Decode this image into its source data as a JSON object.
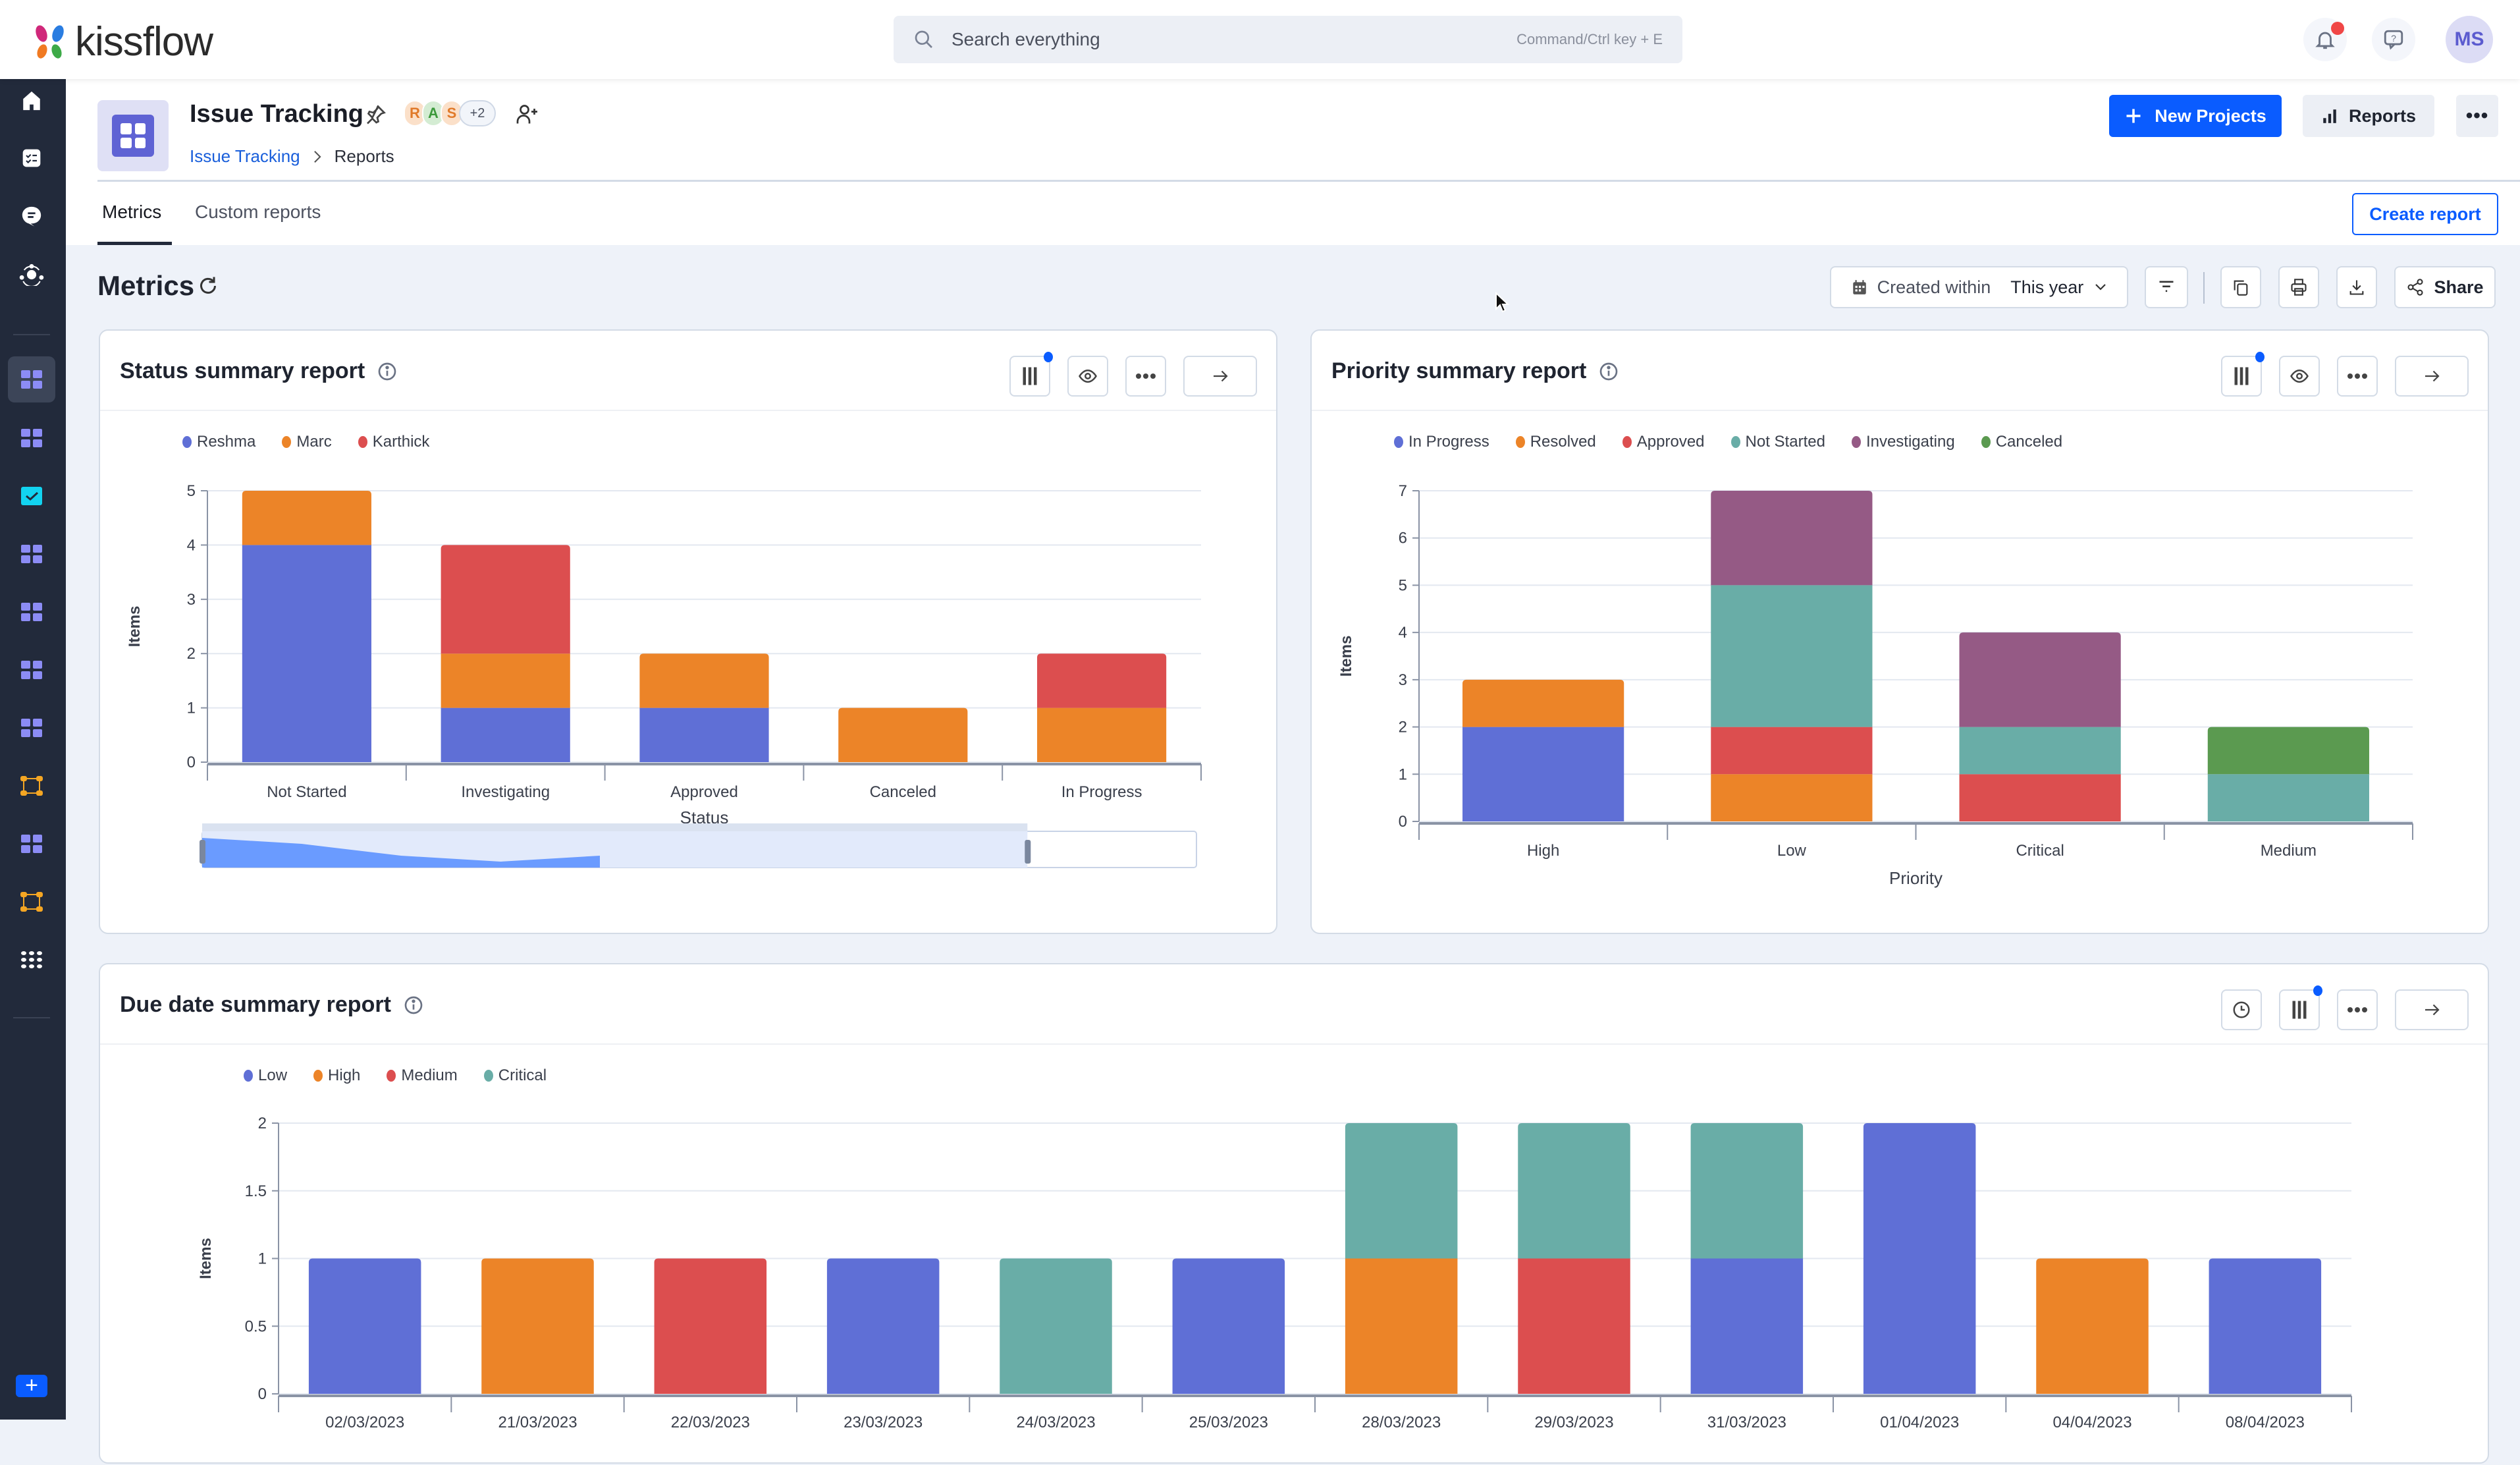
{
  "app": {
    "brand": "kissflow",
    "search_placeholder": "Search everything",
    "search_shortcut": "Command/Ctrl key + E",
    "user_initials": "MS"
  },
  "colors": {
    "primary": "#0a5cff",
    "sidebar_bg": "#222a3b",
    "series_blue": "#5f6fd6",
    "series_orange": "#ec8428",
    "series_red": "#dc4e4f",
    "series_teal": "#69ada7",
    "series_purple": "#955a85",
    "series_green": "#5b9a50"
  },
  "sidebar": {
    "items": [
      {
        "icon": "home-icon"
      },
      {
        "icon": "tasks-icon"
      },
      {
        "icon": "chat-icon"
      },
      {
        "icon": "integrations-icon"
      },
      {
        "icon": "app-grid-icon",
        "active": true
      },
      {
        "icon": "app-grid-icon"
      },
      {
        "icon": "checkbox-icon"
      },
      {
        "icon": "app-grid-icon"
      },
      {
        "icon": "app-grid-icon"
      },
      {
        "icon": "app-grid-icon"
      },
      {
        "icon": "app-grid-icon"
      },
      {
        "icon": "flow-icon"
      },
      {
        "icon": "app-grid-icon"
      },
      {
        "icon": "flow-icon"
      },
      {
        "icon": "all-apps-icon"
      }
    ],
    "add_label": "+"
  },
  "project": {
    "title": "Issue Tracking",
    "members": [
      {
        "initial": "R",
        "bg": "#fbe0c9",
        "fg": "#e07a2a"
      },
      {
        "initial": "A",
        "bg": "#d4ecd3",
        "fg": "#3b9a3b"
      },
      {
        "initial": "S",
        "bg": "#fbe0c9",
        "fg": "#e07a2a"
      }
    ],
    "members_more": "+2",
    "breadcrumb": [
      "Issue Tracking",
      "Reports"
    ],
    "new_button": "New Projects",
    "reports_button": "Reports",
    "more_button": "•••",
    "tabs": [
      "Metrics",
      "Custom reports"
    ],
    "active_tab": "Metrics",
    "create_report": "Create report"
  },
  "metrics": {
    "title": "Metrics",
    "filter_label": "Created within",
    "filter_value": "This year",
    "share_label": "Share"
  },
  "cards": {
    "status": {
      "title": "Status summary report",
      "range_slider": {
        "start_fraction": 0.0,
        "end_fraction": 0.83
      }
    },
    "priority": {
      "title": "Priority summary report"
    },
    "due": {
      "title": "Due date summary report"
    }
  },
  "chart_data": [
    {
      "id": "status",
      "type": "bar",
      "stacked": true,
      "title": "Status summary report",
      "xlabel": "Status",
      "ylabel": "Items",
      "ylim": [
        0,
        5
      ],
      "yticks": [
        0,
        1,
        2,
        3,
        4,
        5
      ],
      "categories": [
        "Not Started",
        "Investigating",
        "Approved",
        "Canceled",
        "In Progress"
      ],
      "series": [
        {
          "name": "Reshma",
          "color": "#5f6fd6",
          "values": [
            4,
            1,
            1,
            0,
            0
          ]
        },
        {
          "name": "Marc",
          "color": "#ec8428",
          "values": [
            1,
            1,
            1,
            1,
            1
          ]
        },
        {
          "name": "Karthick",
          "color": "#dc4e4f",
          "values": [
            0,
            2,
            0,
            0,
            1
          ]
        }
      ],
      "legend": "top-left",
      "grid": true
    },
    {
      "id": "priority",
      "type": "bar",
      "stacked": true,
      "title": "Priority summary report",
      "xlabel": "Priority",
      "ylabel": "Items",
      "ylim": [
        0,
        7
      ],
      "yticks": [
        0,
        1,
        2,
        3,
        4,
        5,
        6,
        7
      ],
      "categories": [
        "High",
        "Low",
        "Critical",
        "Medium"
      ],
      "series": [
        {
          "name": "In Progress",
          "color": "#5f6fd6",
          "values": [
            2,
            0,
            0,
            0
          ]
        },
        {
          "name": "Resolved",
          "color": "#ec8428",
          "values": [
            1,
            1,
            0,
            0
          ]
        },
        {
          "name": "Approved",
          "color": "#dc4e4f",
          "values": [
            0,
            1,
            1,
            0
          ]
        },
        {
          "name": "Not Started",
          "color": "#69ada7",
          "values": [
            0,
            3,
            1,
            1
          ]
        },
        {
          "name": "Investigating",
          "color": "#955a85",
          "values": [
            0,
            2,
            2,
            0
          ]
        },
        {
          "name": "Canceled",
          "color": "#5b9a50",
          "values": [
            0,
            0,
            0,
            1
          ]
        }
      ],
      "legend": "top-left",
      "grid": true
    },
    {
      "id": "due",
      "type": "bar",
      "stacked": true,
      "title": "Due date summary report",
      "xlabel": "",
      "ylabel": "Items",
      "ylim": [
        0,
        2
      ],
      "yticks": [
        0,
        0.5,
        1,
        1.5,
        2
      ],
      "categories": [
        "02/03/2023",
        "21/03/2023",
        "22/03/2023",
        "23/03/2023",
        "24/03/2023",
        "25/03/2023",
        "28/03/2023",
        "29/03/2023",
        "31/03/2023",
        "01/04/2023",
        "04/04/2023",
        "08/04/2023"
      ],
      "series": [
        {
          "name": "Low",
          "color": "#5f6fd6",
          "values": [
            1,
            0,
            0,
            1,
            0,
            1,
            0,
            0,
            1,
            2,
            0,
            1
          ]
        },
        {
          "name": "High",
          "color": "#ec8428",
          "values": [
            0,
            1,
            0,
            0,
            0,
            0,
            1,
            0,
            0,
            0,
            1,
            0
          ]
        },
        {
          "name": "Medium",
          "color": "#dc4e4f",
          "values": [
            0,
            0,
            1,
            0,
            0,
            0,
            0,
            1,
            0,
            0,
            0,
            0
          ]
        },
        {
          "name": "Critical",
          "color": "#69ada7",
          "values": [
            0,
            0,
            0,
            0,
            1,
            0,
            1,
            1,
            1,
            0,
            0,
            0
          ]
        }
      ],
      "legend": "top-left",
      "grid": true
    }
  ]
}
